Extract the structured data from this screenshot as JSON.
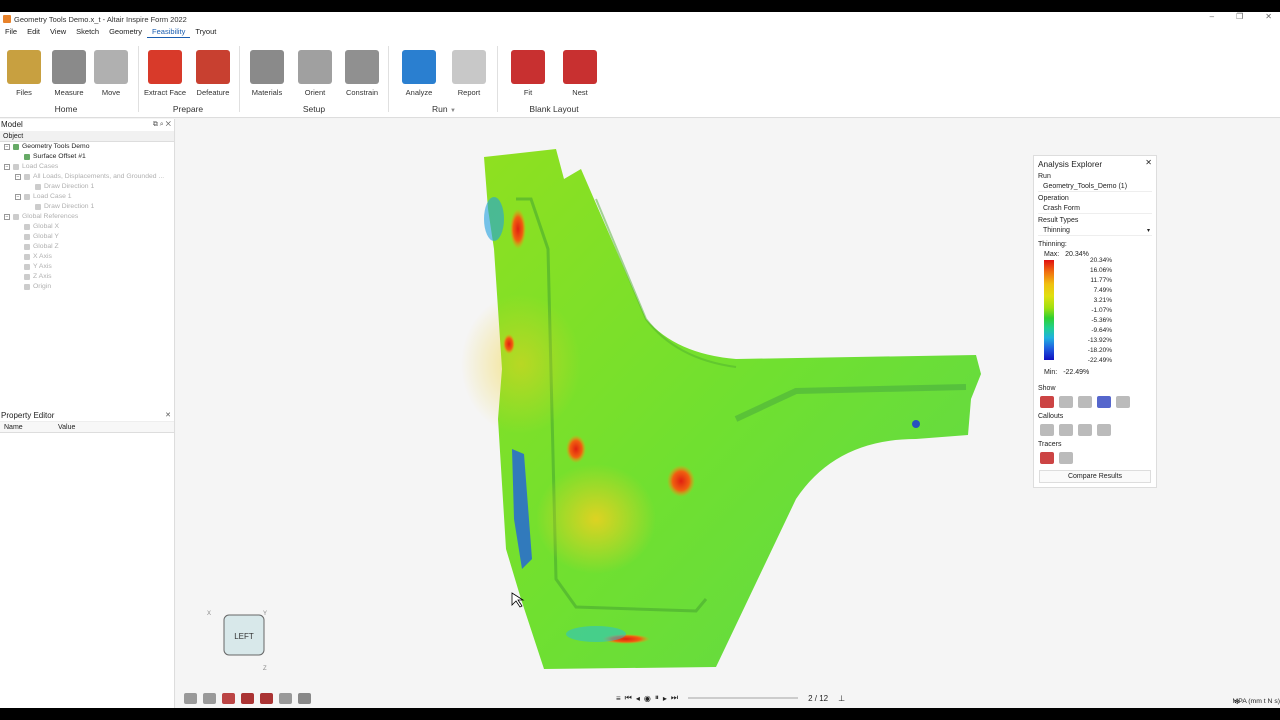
{
  "window": {
    "title": "Geometry Tools Demo.x_t - Altair Inspire Form 2022"
  },
  "menu": [
    "File",
    "Edit",
    "View",
    "Sketch",
    "Geometry",
    "Feasibility",
    "Tryout"
  ],
  "ribbon": {
    "tools": [
      {
        "label": "Files",
        "color": "#c8a040"
      },
      {
        "label": "Measure",
        "color": "#8a8a8a"
      },
      {
        "label": "Move",
        "color": "#b0b0b0"
      },
      {
        "label": "Extract Face",
        "color": "#d83a2a"
      },
      {
        "label": "Defeature",
        "color": "#c84030"
      },
      {
        "label": "Materials",
        "color": "#8a8a8a"
      },
      {
        "label": "Orient",
        "color": "#a0a0a0"
      },
      {
        "label": "Constrain",
        "color": "#909090"
      },
      {
        "label": "Analyze",
        "color": "#2a7fd0"
      },
      {
        "label": "Report",
        "color": "#c8c8c8"
      },
      {
        "label": "Fit",
        "color": "#c83030"
      },
      {
        "label": "Nest",
        "color": "#c83030"
      }
    ],
    "groups": [
      "Home",
      "Prepare",
      "Setup",
      "Run",
      "Blank Layout"
    ]
  },
  "model_panel": {
    "title": "Model",
    "column": "Object",
    "tree": [
      {
        "label": "Geometry Tools Demo",
        "indent": 0,
        "dim": false,
        "exp": "−"
      },
      {
        "label": "Surface Offset #1",
        "indent": 1,
        "dim": false,
        "exp": ""
      },
      {
        "label": "Load Cases",
        "indent": 0,
        "dim": true,
        "exp": "−"
      },
      {
        "label": "All Loads, Displacements, and Grounded ...",
        "indent": 1,
        "dim": true,
        "exp": "−"
      },
      {
        "label": "Draw Direction 1",
        "indent": 2,
        "dim": true,
        "exp": ""
      },
      {
        "label": "Load Case 1",
        "indent": 1,
        "dim": true,
        "exp": "−"
      },
      {
        "label": "Draw Direction 1",
        "indent": 2,
        "dim": true,
        "exp": ""
      },
      {
        "label": "Global References",
        "indent": 0,
        "dim": true,
        "exp": "−"
      },
      {
        "label": "Global X",
        "indent": 1,
        "dim": true,
        "exp": ""
      },
      {
        "label": "Global Y",
        "indent": 1,
        "dim": true,
        "exp": ""
      },
      {
        "label": "Global Z",
        "indent": 1,
        "dim": true,
        "exp": ""
      },
      {
        "label": "X Axis",
        "indent": 1,
        "dim": true,
        "exp": ""
      },
      {
        "label": "Y Axis",
        "indent": 1,
        "dim": true,
        "exp": ""
      },
      {
        "label": "Z Axis",
        "indent": 1,
        "dim": true,
        "exp": ""
      },
      {
        "label": "Origin",
        "indent": 1,
        "dim": true,
        "exp": ""
      }
    ]
  },
  "property_panel": {
    "title": "Property Editor",
    "col_name": "Name",
    "col_value": "Value"
  },
  "analysis": {
    "title": "Analysis Explorer",
    "run_label": "Run",
    "run_value": "Geometry_Tools_Demo (1)",
    "operation_label": "Operation",
    "operation_value": "Crash Form",
    "result_types_label": "Result Types",
    "result_type_value": "Thinning",
    "thinning_label": "Thinning:",
    "max_label": "Max:",
    "max_value": "20.34%",
    "min_label": "Min:",
    "min_value": "-22.49%",
    "legend": [
      "20.34%",
      "16.06%",
      "11.77%",
      "7.49%",
      "3.21%",
      "-1.07%",
      "-5.36%",
      "-9.64%",
      "-13.92%",
      "-18.20%",
      "-22.49%"
    ],
    "show_label": "Show",
    "callouts_label": "Callouts",
    "tracers_label": "Tracers",
    "compare_button": "Compare Results"
  },
  "viewcube": {
    "face": "LEFT",
    "x": "X",
    "y": "Y",
    "z": "Z"
  },
  "playback": {
    "frame": "2 / 12"
  },
  "status": {
    "units": "MPA (mm t N s)"
  }
}
